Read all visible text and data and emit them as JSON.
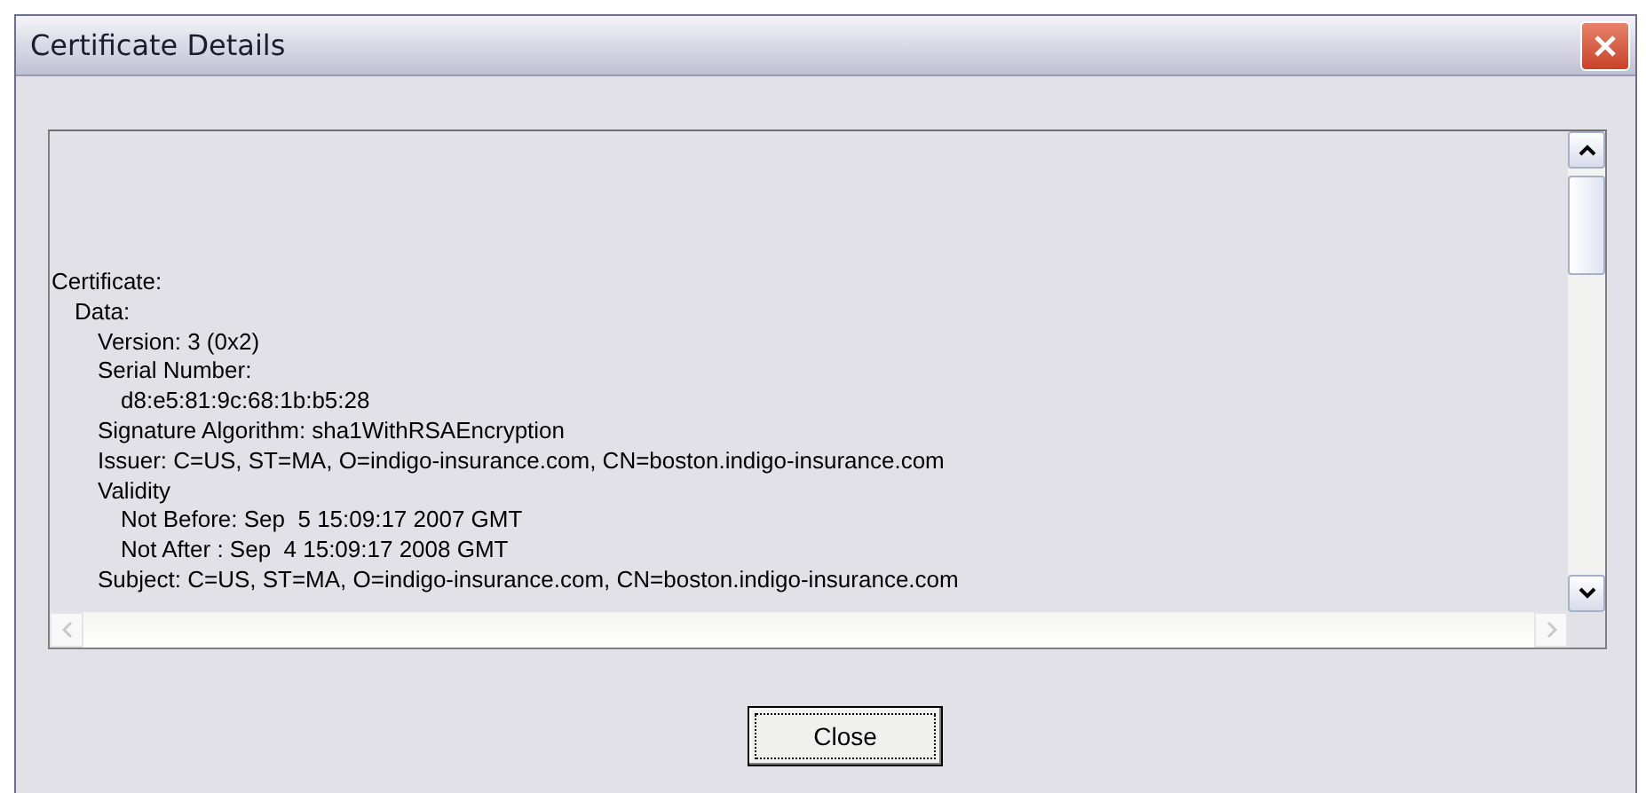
{
  "window": {
    "title": "Certificate Details"
  },
  "details": [
    {
      "text": "Certificate:",
      "children": [
        {
          "text": "Data:",
          "children": [
            {
              "text": "Version: 3 (0x2)"
            },
            {
              "text": "Serial Number:",
              "children": [
                {
                  "text": "d8:e5:81:9c:68:1b:b5:28"
                }
              ]
            },
            {
              "text": "Signature Algorithm: sha1WithRSAEncryption"
            },
            {
              "text": "Issuer: C=US, ST=MA, O=indigo-insurance.com, CN=boston.indigo-insurance.com"
            },
            {
              "text": "Validity",
              "children": [
                {
                  "text": "Not Before: Sep  5 15:09:17 2007 GMT"
                },
                {
                  "text": "Not After : Sep  4 15:09:17 2008 GMT"
                }
              ]
            },
            {
              "text": "Subject: C=US, ST=MA, O=indigo-insurance.com, CN=boston.indigo-insurance.com"
            }
          ]
        }
      ]
    }
  ],
  "buttons": [
    {
      "label": "Close"
    }
  ]
}
